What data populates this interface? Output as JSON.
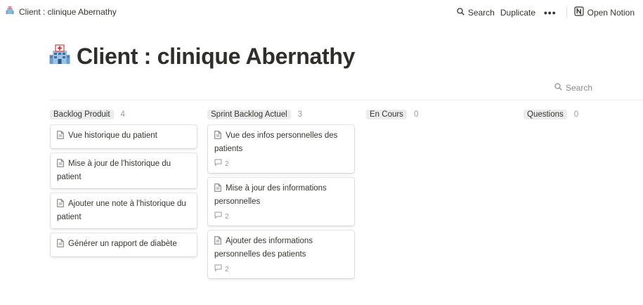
{
  "topbar": {
    "breadcrumb": "Client : clinique Abernathy",
    "search_label": "Search",
    "duplicate_label": "Duplicate",
    "more_label": "•••",
    "open_notion_label": "Open Notion"
  },
  "page": {
    "title": "Client : clinique Abernathy",
    "icon": "hospital-icon"
  },
  "board": {
    "search_label": "Search",
    "columns": [
      {
        "label": "Backlog Produit",
        "count": "4",
        "cards": [
          {
            "title": "Vue historique du patient"
          },
          {
            "title": "Mise à jour de l'historique du patient"
          },
          {
            "title": "Ajouter une note à l'historique du patient"
          },
          {
            "title": "Générer un rapport de diabète"
          }
        ]
      },
      {
        "label": "Sprint Backlog Actuel",
        "count": "3",
        "cards": [
          {
            "title": "Vue des infos personnelles des patients",
            "comments": "2"
          },
          {
            "title": "Mise à jour des informations personnelles",
            "comments": "2"
          },
          {
            "title": "Ajouter des informations personnelles des patients",
            "comments": "2"
          }
        ]
      },
      {
        "label": "En Cours",
        "count": "0",
        "cards": []
      },
      {
        "label": "Questions",
        "count": "0",
        "cards": []
      }
    ]
  },
  "colors": {
    "text": "#37352f",
    "muted": "#9b9a97",
    "label_bg": "#ebeced",
    "divider": "#ededec"
  }
}
